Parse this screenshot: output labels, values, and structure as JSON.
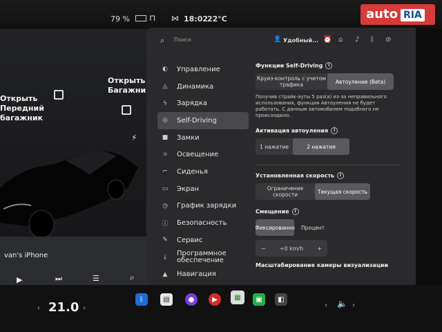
{
  "status": {
    "battery": "79 %",
    "time": "18:02",
    "temp": "22°C"
  },
  "watermark": {
    "auto": "auto",
    "ria": "RIA",
    "sub": ".com"
  },
  "car": {
    "front_trunk": "Открыть\nПередний\nбагажник",
    "rear_trunk": "Открыть\nБагажник"
  },
  "media": {
    "track": "van's iPhone"
  },
  "search": {
    "placeholder": "Поиск"
  },
  "profile": {
    "name": "Удобный..."
  },
  "nav": [
    {
      "label": "Управление",
      "icon": "toggle-icon"
    },
    {
      "label": "Динамика",
      "icon": "car-icon"
    },
    {
      "label": "Зарядка",
      "icon": "bolt-icon"
    },
    {
      "label": "Self-Driving",
      "icon": "steering-icon"
    },
    {
      "label": "Замки",
      "icon": "lock-icon"
    },
    {
      "label": "Освещение",
      "icon": "sun-icon"
    },
    {
      "label": "Сиденья",
      "icon": "seat-icon"
    },
    {
      "label": "Экран",
      "icon": "screen-icon"
    },
    {
      "label": "График зарядки",
      "icon": "clock-icon"
    },
    {
      "label": "Безопасность",
      "icon": "shield-icon"
    },
    {
      "label": "Сервис",
      "icon": "wrench-icon"
    },
    {
      "label": "Программное обеспечение",
      "icon": "download-icon"
    },
    {
      "label": "Навигация",
      "icon": "nav-icon"
    }
  ],
  "self_driving": {
    "functions_title": "Функции Self-Driving",
    "functions_opt1": "Круиз-контроль с учетом трафика",
    "functions_opt2": "Автоуление (Beta)",
    "warning": "Получив страйк-ауты 5 раз(а) из-за неправильного использования, функция Автоуления не будет работать. С данным автомобилем подобного не происходило.",
    "activation_title": "Активация автоуления",
    "activation_opt1": "1 нажатие",
    "activation_opt2": "2 нажатия",
    "speed_title": "Установленная скорость",
    "speed_opt1": "Ограничение скорости",
    "speed_opt2": "Текущая скорость",
    "offset_title": "Смещение",
    "offset_opt1": "Фиксированно",
    "offset_opt2": "Процент",
    "offset_value": "+0 km/h",
    "camera_title": "Масштабирование камеры визуализации"
  },
  "climate": {
    "temp": "21.0"
  }
}
